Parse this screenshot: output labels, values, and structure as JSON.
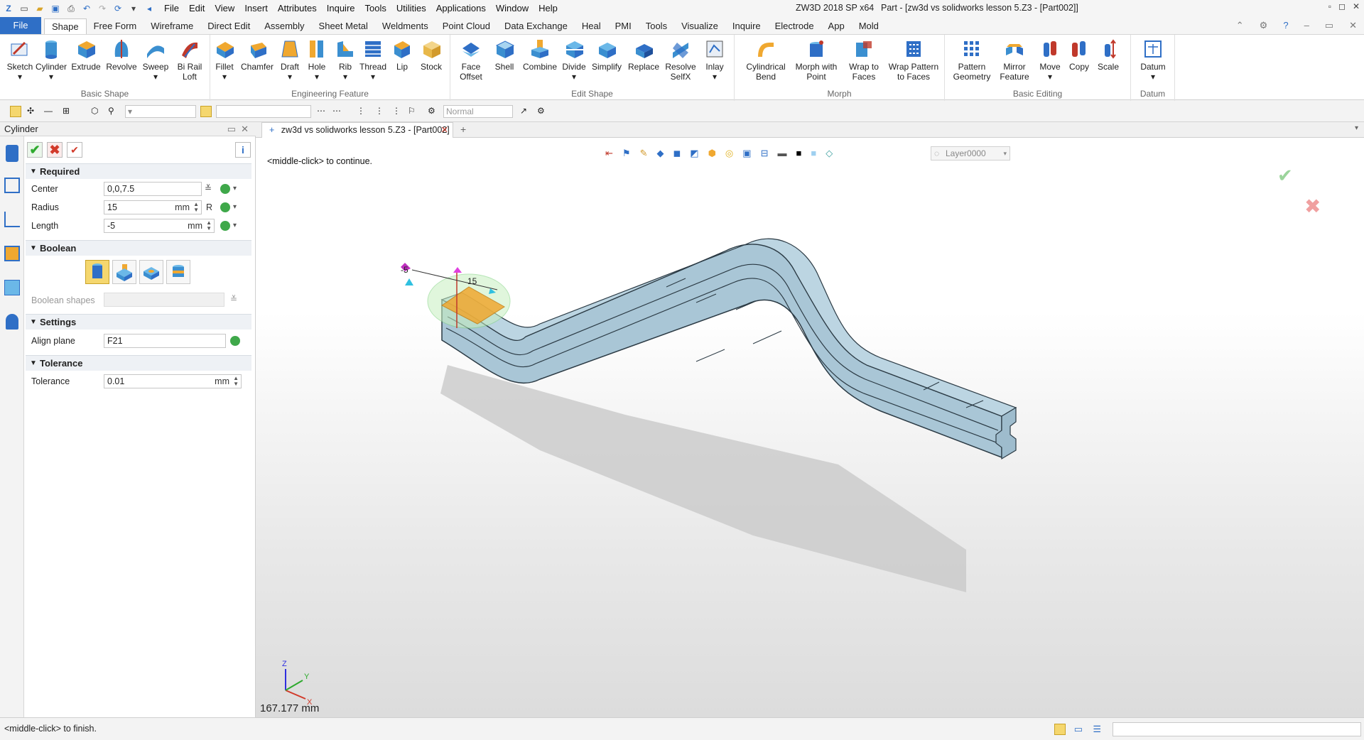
{
  "title": {
    "app": "ZW3D 2018 SP x64",
    "document": "Part - [zw3d vs solidworks lesson 5.Z3 - [Part002]]"
  },
  "menu": [
    "File",
    "Edit",
    "View",
    "Insert",
    "Attributes",
    "Inquire",
    "Tools",
    "Utilities",
    "Applications",
    "Window",
    "Help"
  ],
  "tabs": [
    "File",
    "Shape",
    "Free Form",
    "Wireframe",
    "Direct Edit",
    "Assembly",
    "Sheet Metal",
    "Weldments",
    "Point Cloud",
    "Data Exchange",
    "Heal",
    "PMI",
    "Tools",
    "Visualize",
    "Inquire",
    "Electrode",
    "App",
    "Mold"
  ],
  "active_tab": "Shape",
  "ribbon": {
    "basic_shape": {
      "label": "Basic Shape",
      "tools": [
        "Sketch",
        "Cylinder",
        "Extrude",
        "Revolve",
        "Sweep",
        "Bi Rail Loft"
      ]
    },
    "engineering_feature": {
      "label": "Engineering Feature",
      "tools": [
        "Fillet",
        "Chamfer",
        "Draft",
        "Hole",
        "Rib",
        "Thread",
        "Lip",
        "Stock"
      ]
    },
    "edit_shape": {
      "label": "Edit Shape",
      "tools": [
        "Face Offset",
        "Shell",
        "Combine",
        "Divide",
        "Simplify",
        "Replace",
        "Resolve SelfX",
        "Inlay"
      ]
    },
    "morph": {
      "label": "Morph",
      "tools": [
        "Cylindrical Bend",
        "Morph with Point",
        "Wrap to Faces",
        "Wrap Pattern to Faces"
      ]
    },
    "basic_editing": {
      "label": "Basic Editing",
      "tools": [
        "Pattern Geometry",
        "Mirror Feature",
        "Move",
        "Copy",
        "Scale"
      ]
    },
    "datum": {
      "label": "Datum",
      "tools": [
        "Datum"
      ]
    }
  },
  "toolbar2": {
    "render_mode": "Normal"
  },
  "panel": {
    "title": "Cylinder",
    "required_label": "Required",
    "center_label": "Center",
    "center_value": "0,0,7.5",
    "radius_label": "Radius",
    "radius_value": "15",
    "radius_unit": "mm",
    "radius_suffix": "R",
    "length_label": "Length",
    "length_value": "-5",
    "length_unit": "mm",
    "boolean_label": "Boolean",
    "boolean_shapes_label": "Boolean shapes",
    "settings_label": "Settings",
    "align_plane_label": "Align plane",
    "align_plane_value": "F21",
    "tolerance_section_label": "Tolerance",
    "tolerance_label": "Tolerance",
    "tolerance_value": "0.01",
    "tolerance_unit": "mm"
  },
  "doc_tab": "zw3d vs solidworks lesson 5.Z3 - [Part002]",
  "viewport": {
    "prompt": "<middle-click> to continue.",
    "layer": "Layer0000",
    "measure": "167.177 mm",
    "dim_radius": "15",
    "dim_length": "-5",
    "axis_x": "X",
    "axis_y": "Y",
    "axis_z": "Z"
  },
  "status": {
    "text": "<middle-click> to finish."
  },
  "colors": {
    "accent": "#2f6fc6",
    "part": "#a9c6d6",
    "part_edge": "#2b3a44",
    "highlight": "#f0a830",
    "ok": "#2eaa2e",
    "cancel": "#d23a2a"
  }
}
